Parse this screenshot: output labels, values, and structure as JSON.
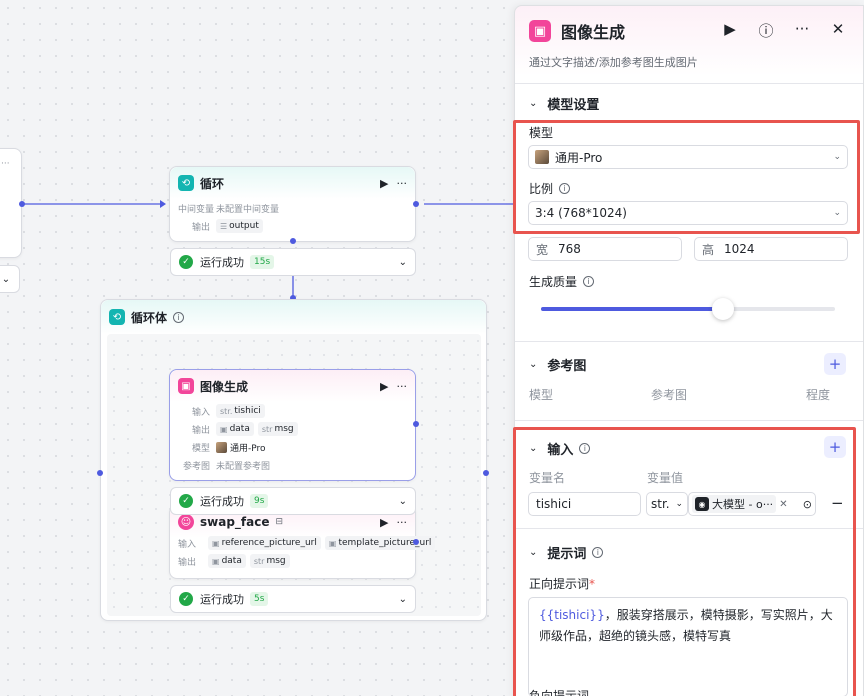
{
  "loop_node": {
    "title": "循环",
    "var_label": "中间变量",
    "var_value": "未配置中间变量",
    "output_label": "输出",
    "output_tag": "output",
    "status": "运行成功",
    "duration": "15s"
  },
  "loop_body": {
    "title": "循环体"
  },
  "imggen_node": {
    "title": "图像生成",
    "input_label": "输入",
    "input_tag": "tishici",
    "input_tag_type": "str.",
    "output_label": "输出",
    "output_tag1": "data",
    "output_tag2": "msg",
    "output_tag2_type": "str",
    "model_label": "模型",
    "model_value": "通用-Pro",
    "ref_label": "参考图",
    "ref_value": "未配置参考图",
    "status": "运行成功",
    "duration": "9s"
  },
  "swap_node": {
    "title": "swap_face",
    "input_label": "输入",
    "input_tag1": "reference_picture_url",
    "input_tag2": "template_picture_url",
    "output_label": "输出",
    "output_tag1": "data",
    "output_tag2": "msg",
    "output_tag2_type": "str",
    "status": "运行成功",
    "duration": "5s"
  },
  "panel": {
    "title": "图像生成",
    "description": "通过文字描述/添加参考图生成图片",
    "model_section": "模型设置",
    "model_label": "模型",
    "model_value": "通用-Pro",
    "ratio_label": "比例",
    "ratio_value": "3:4 (768*1024)",
    "width_prefix": "宽",
    "width_value": "768",
    "height_prefix": "高",
    "height_value": "1024",
    "quality_label": "生成质量",
    "quality_level": 0.62,
    "ref_section": "参考图",
    "ref_col1": "模型",
    "ref_col2": "参考图",
    "ref_col3": "程度",
    "input_section": "输入",
    "var_name_col": "变量名",
    "var_value_col": "变量值",
    "var_name": "tishici",
    "var_type": "str.",
    "var_ref": "大模型 - o···",
    "prompt_section": "提示词",
    "positive_label": "正向提示词",
    "required_mark": "*",
    "prompt_var": "{{tishici}}",
    "prompt_text": "，服装穿搭展示，模特摄影，写实照片，大师级作品，超绝的镜头感，模特写真",
    "negative_label": "负向提示词"
  },
  "colors": {
    "accent": "#4e5adf",
    "success": "#22a848",
    "highlight_border": "#e8544e",
    "image_icon": "#f2459a",
    "loop_icon": "#13b5b1"
  }
}
